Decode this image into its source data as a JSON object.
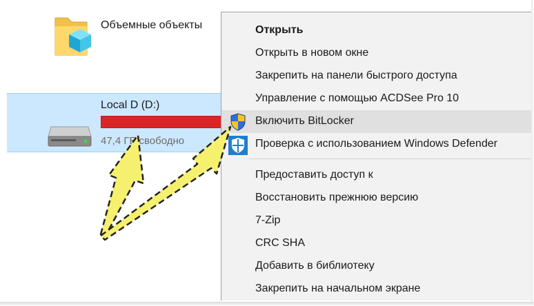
{
  "explorer": {
    "items": [
      {
        "name": "Объемные объекты"
      },
      {
        "name": "Local D (D:)",
        "subtitle": "47,4 ГБ свободно",
        "usage_fraction": 0.95,
        "bar_color": "#da2626"
      }
    ]
  },
  "context_menu": {
    "items": [
      {
        "label": "Открыть"
      },
      {
        "label": "Открыть в новом окне"
      },
      {
        "label": "Закрепить на панели быстрого доступа"
      },
      {
        "label": "Управление с помощью ACDSee Pro 10"
      },
      {
        "label": "Включить BitLocker",
        "icon": "uac-shield-icon"
      },
      {
        "label": "Проверка с использованием Windows Defender",
        "icon": "defender-icon"
      },
      {
        "label": "Предоставить доступ к"
      },
      {
        "label": "Восстановить прежнюю версию"
      },
      {
        "label": "7-Zip"
      },
      {
        "label": "CRC SHA"
      },
      {
        "label": "Добавить в библиотеку"
      },
      {
        "label": "Закрепить на начальном экране"
      }
    ]
  },
  "colors": {
    "selection": "#cce8ff",
    "menu_background": "#f2f2f2",
    "menu_highlight": "#e0e0e0",
    "arrow_fill": "#f5f06e"
  }
}
